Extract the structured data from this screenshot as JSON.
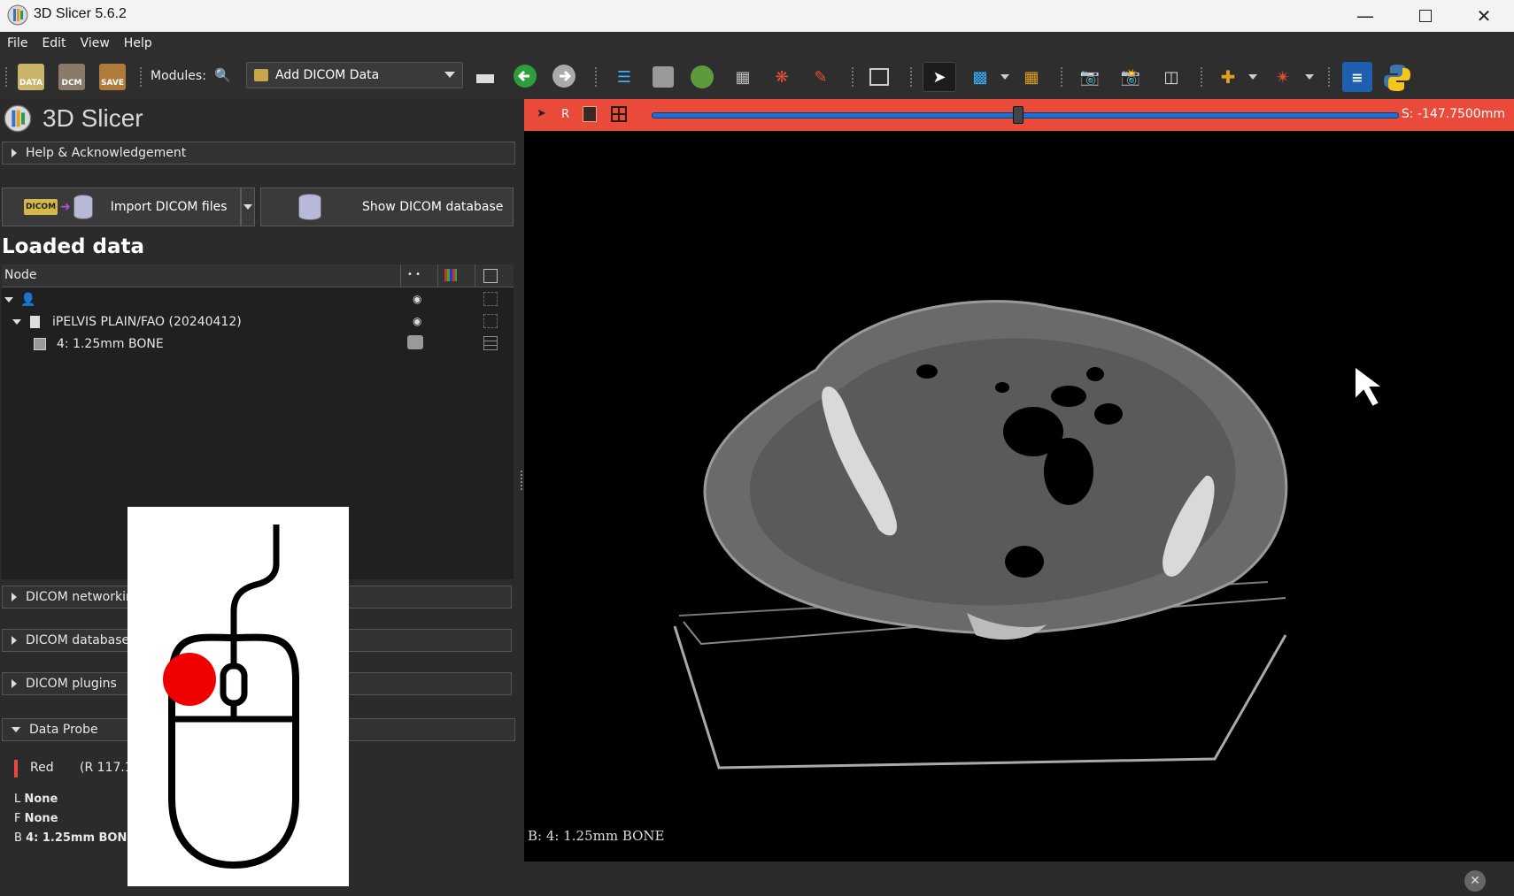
{
  "window": {
    "title": "3D Slicer 5.6.2"
  },
  "menubar": [
    "File",
    "Edit",
    "View",
    "Help"
  ],
  "toolbar": {
    "data_label": "DATA",
    "dcm_label": "DCM",
    "save_label": "SAVE",
    "modules_label": "Modules:",
    "module_selected": "Add DICOM Data"
  },
  "panel": {
    "logo_title": "3D Slicer",
    "help_section": "Help & Acknowledgement",
    "import_button": "Import DICOM files",
    "show_db_button": "Show DICOM database",
    "dicom_badge": "DICOM",
    "loaded_data_title": "Loaded data",
    "tree_header_node": "Node",
    "tree": [
      {
        "label": "",
        "kind": "patient"
      },
      {
        "label": "iPELVIS PLAIN/FAO (20240412)",
        "kind": "study"
      },
      {
        "label": "4: 1.25mm BONE",
        "kind": "volume"
      }
    ],
    "sections": [
      "DICOM networkin",
      "DICOM database",
      "DICOM plugins"
    ],
    "data_probe_title": "Data Probe",
    "probe": {
      "view_name": "Red",
      "coords": "(R 117.1",
      "L_key": "L",
      "L_val": "None",
      "F_key": "F",
      "F_val": "None",
      "B_key": "B",
      "B_val": "4: 1.25mm BONE"
    }
  },
  "slice_view": {
    "orientation_label": "R",
    "offset_label": "S: -147.7500mm",
    "slider_fraction": 0.49,
    "background_label": "B: 4: 1.25mm BONE",
    "bar_color": "#e94a3a"
  }
}
